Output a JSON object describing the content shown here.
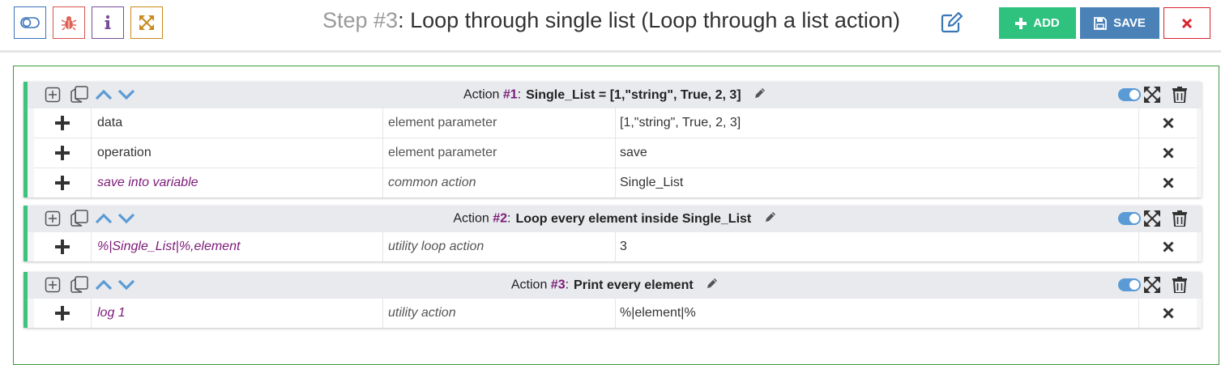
{
  "toolbar": {
    "icons": [
      "toggle-icon",
      "bug-icon",
      "info-icon",
      "expand-icon"
    ],
    "colors": {
      "toggle": "#3b73b9",
      "bug": "#d9534f",
      "info": "#7a4f9a",
      "expand": "#c98a1e"
    }
  },
  "step": {
    "prefix": "Step #3",
    "title": ": Loop through single list (Loop through a list action)"
  },
  "buttons": {
    "add": "ADD",
    "save": "SAVE",
    "colors": {
      "add": "#2ec27e",
      "save": "#4a82b8",
      "close": "#d9232d"
    }
  },
  "actions": [
    {
      "label": "Action",
      "number": "#1",
      "description": "Single_List = [1,\"string\", True, 2, 3]",
      "rows": [
        {
          "field": "data",
          "type": "element parameter",
          "value": "[1,\"string\", True, 2, 3]"
        },
        {
          "field": "operation",
          "type": "element parameter",
          "value": "save"
        },
        {
          "field": "save into variable",
          "type": "common action",
          "value": "Single_List"
        }
      ]
    },
    {
      "label": "Action",
      "number": "#2",
      "description": "Loop every element inside Single_List",
      "rows": [
        {
          "field": "%|Single_List|%,element",
          "type": "utility loop action",
          "value": "3"
        }
      ]
    },
    {
      "label": "Action",
      "number": "#3",
      "description": "Print every element",
      "rows": [
        {
          "field": "log 1",
          "type": "utility action",
          "value": "%|element|%"
        }
      ]
    }
  ],
  "colors": {
    "accent_border": "#3cc47c",
    "action_number": "#7c1a78",
    "panel_border": "#3e9b3e"
  }
}
